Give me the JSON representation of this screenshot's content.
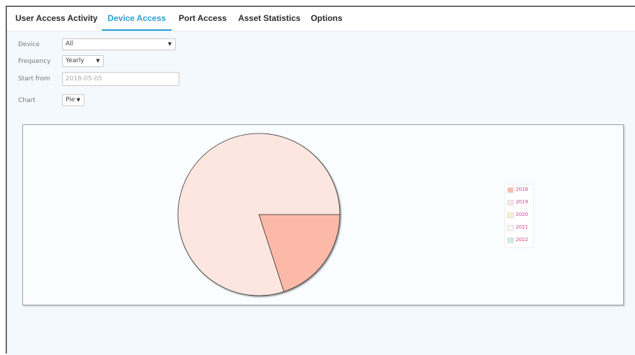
{
  "tabs": [
    {
      "label": "User Access Activity",
      "active": false
    },
    {
      "label": "Device Access",
      "active": true
    },
    {
      "label": "Port Access",
      "active": false
    },
    {
      "label": "Asset Statistics",
      "active": false
    },
    {
      "label": "Options",
      "active": false
    }
  ],
  "form": {
    "device": {
      "label": "Device",
      "value": "All"
    },
    "frequency": {
      "label": "Frequency",
      "value": "Yearly"
    },
    "start": {
      "label": "Start from",
      "value": "2018-05-05"
    },
    "chart": {
      "label": "Chart",
      "value": "Pie"
    }
  },
  "colors": {
    "accent": "#2b9fd4",
    "legend_text": "#d0458a"
  },
  "icons": {
    "dropdown": "caret-down-icon"
  },
  "chart_data": {
    "type": "pie",
    "title": "",
    "series": [
      {
        "name": "2018",
        "value": 20,
        "color": "#fdb9a8"
      },
      {
        "name": "2019",
        "value": 80,
        "color": "#fde6e0"
      },
      {
        "name": "2020",
        "value": 0,
        "color": "#fdf0c8"
      },
      {
        "name": "2021",
        "value": 0,
        "color": "#fff8f4"
      },
      {
        "name": "2022",
        "value": 0,
        "color": "#c8eedd"
      }
    ],
    "legend_position": "right"
  }
}
